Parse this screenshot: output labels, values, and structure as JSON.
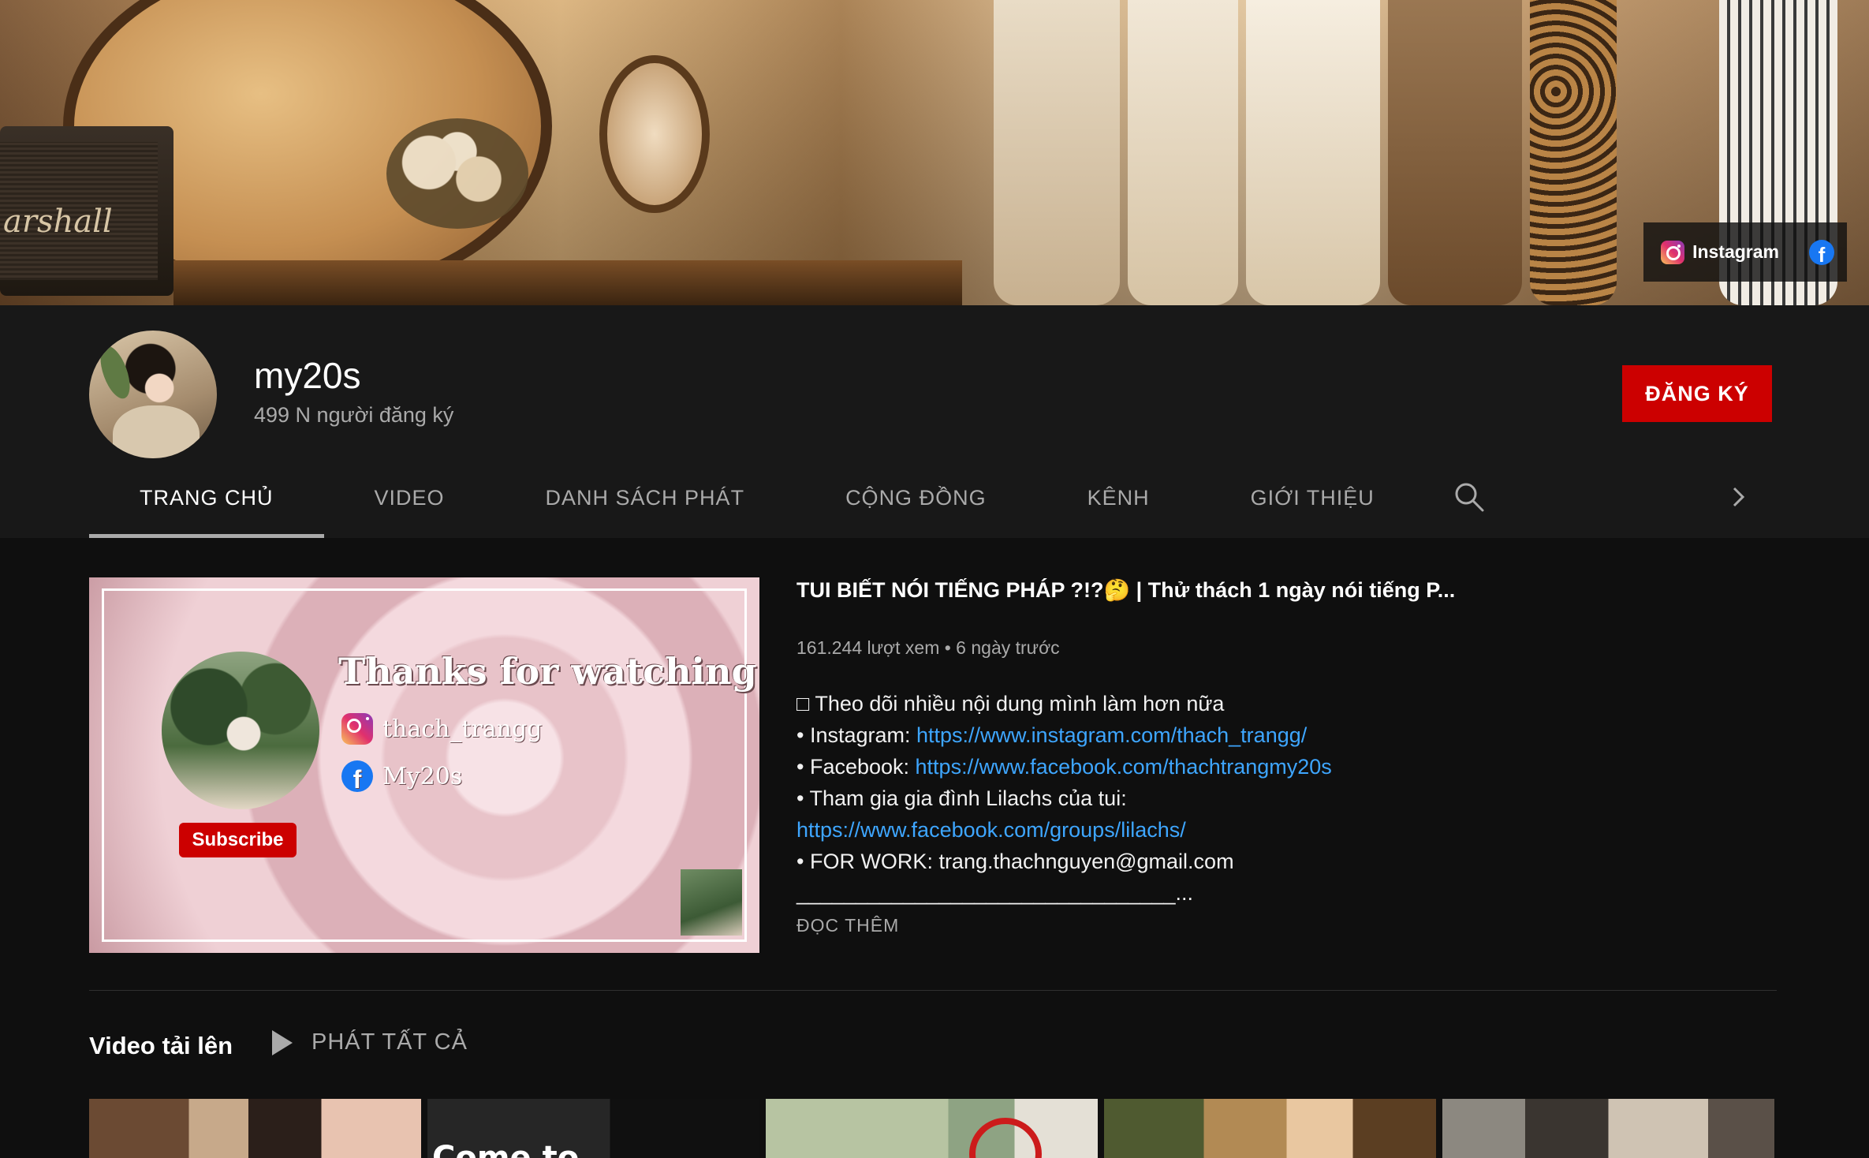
{
  "banner": {
    "speaker_brand": "arshall",
    "links": [
      {
        "label": "Instagram",
        "icon": "instagram-icon"
      },
      {
        "label": "",
        "icon": "facebook-icon"
      }
    ]
  },
  "channel": {
    "name": "my20s",
    "subscribers": "499 N người đăng ký",
    "subscribe_label": "ĐĂNG KÝ"
  },
  "tabs": [
    {
      "label": "TRANG CHỦ",
      "active": true
    },
    {
      "label": "VIDEO",
      "active": false
    },
    {
      "label": "DANH SÁCH PHÁT",
      "active": false
    },
    {
      "label": "CỘNG ĐỒNG",
      "active": false
    },
    {
      "label": "KÊNH",
      "active": false
    },
    {
      "label": "GIỚI THIỆU",
      "active": false
    }
  ],
  "featured": {
    "thumbnail": {
      "thanks_text": "Thanks for watching",
      "instagram_handle": "thach_trangg",
      "facebook_handle": "My20s",
      "subscribe_label": "Subscribe"
    },
    "title": "TUI BIẾT NÓI TIẾNG PHÁP ?!?🤔 | Thử thách 1 ngày nói tiếng P...",
    "meta": "161.244 lượt xem • 6 ngày trước",
    "description": {
      "line1": "□ Theo dõi nhiều nội dung mình làm hơn nữa",
      "instagram_prefix": "• Instagram: ",
      "instagram_url": "https://www.instagram.com/thach_trangg/",
      "facebook_prefix": "• Facebook: ",
      "facebook_url": "https://www.facebook.com/thachtrangmy20s",
      "group_line": "• Tham gia gia đình Lilachs của tui:",
      "group_url": "https://www.facebook.com/groups/lilachs/",
      "work_line": "• FOR WORK: trang.thachnguyen@gmail.com",
      "separator": "________________________________..."
    },
    "read_more": "ĐỌC THÊM"
  },
  "uploads": {
    "title": "Video tải lên",
    "play_all": "PHÁT TẤT CẢ",
    "thumb_text": "Come to"
  },
  "colors": {
    "background": "#0f0f0f",
    "header": "#181818",
    "subscribe": "#cc0000",
    "link": "#3ea6ff",
    "muted": "#aaaaaa"
  }
}
